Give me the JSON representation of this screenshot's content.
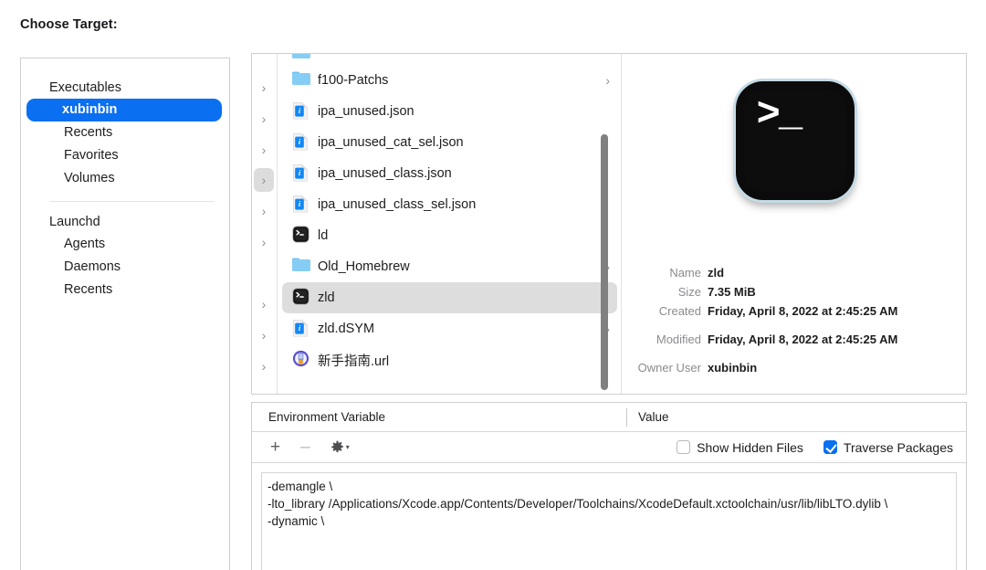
{
  "heading": "Choose Target:",
  "colors": {
    "accent": "#0a6ff0",
    "selected_row": "#dddddd",
    "panel_border": "#cfcfd1",
    "label_gray": "#8b8b90",
    "scrollbar": "#808080"
  },
  "sidebar": {
    "groups": [
      {
        "header": "Executables",
        "items": [
          {
            "label": "xubinbin",
            "selected": true
          },
          {
            "label": "Recents",
            "selected": false
          },
          {
            "label": "Favorites",
            "selected": false
          },
          {
            "label": "Volumes",
            "selected": false
          }
        ]
      },
      {
        "header": "Launchd",
        "items": [
          {
            "label": "Agents",
            "selected": false
          },
          {
            "label": "Daemons",
            "selected": false
          },
          {
            "label": "Recents",
            "selected": false
          }
        ]
      }
    ]
  },
  "browser": {
    "chevron_strip": {
      "icon": "chevron-right-icon",
      "count": 9,
      "highlighted_index": 3
    },
    "files": [
      {
        "name": "",
        "icon": "folder-icon",
        "clipped": true,
        "has_chevron": false,
        "selected": false
      },
      {
        "name": "f100-Patchs",
        "icon": "folder-icon",
        "has_chevron": true,
        "selected": false
      },
      {
        "name": "ipa_unused.json",
        "icon": "json-file-icon",
        "has_chevron": false,
        "selected": false
      },
      {
        "name": "ipa_unused_cat_sel.json",
        "icon": "json-file-icon",
        "has_chevron": false,
        "selected": false
      },
      {
        "name": "ipa_unused_class.json",
        "icon": "json-file-icon",
        "has_chevron": false,
        "selected": false
      },
      {
        "name": "ipa_unused_class_sel.json",
        "icon": "json-file-icon",
        "has_chevron": false,
        "selected": false
      },
      {
        "name": "ld",
        "icon": "terminal-executable-icon",
        "has_chevron": false,
        "selected": false
      },
      {
        "name": "Old_Homebrew",
        "icon": "folder-icon",
        "has_chevron": true,
        "selected": false
      },
      {
        "name": "zld",
        "icon": "terminal-executable-icon",
        "has_chevron": false,
        "selected": true
      },
      {
        "name": "zld.dSYM",
        "icon": "json-file-icon",
        "has_chevron": true,
        "selected": false
      },
      {
        "name": "新手指南.url",
        "icon": "url-file-icon",
        "has_chevron": false,
        "selected": false
      }
    ],
    "preview": {
      "icon": "terminal-executable-icon",
      "icon_prompt": ">_",
      "fields": [
        {
          "label": "Name",
          "value": "zld",
          "gap": false
        },
        {
          "label": "Size",
          "value": "7.35 MiB",
          "gap": false
        },
        {
          "label": "Created",
          "value": "Friday, April 8, 2022 at 2:45:25 AM",
          "gap": false
        },
        {
          "label": "Modified",
          "value": "Friday, April 8, 2022 at 2:45:25 AM",
          "gap": true
        },
        {
          "label": "Owner User",
          "value": "xubinbin",
          "gap": true
        }
      ]
    }
  },
  "env_panel": {
    "columns": {
      "name": "Environment Variable",
      "value": "Value"
    },
    "toolbar": {
      "add": "+",
      "remove": "–",
      "gear_icon": "gear-icon",
      "gear_caret": "▾"
    },
    "checkboxes": [
      {
        "label": "Show Hidden Files",
        "checked": false
      },
      {
        "label": "Traverse Packages",
        "checked": true
      }
    ],
    "arguments_text": "-demangle \\\n-lto_library /Applications/Xcode.app/Contents/Developer/Toolchains/XcodeDefault.xctoolchain/usr/lib/libLTO.dylib \\\n-dynamic \\"
  }
}
